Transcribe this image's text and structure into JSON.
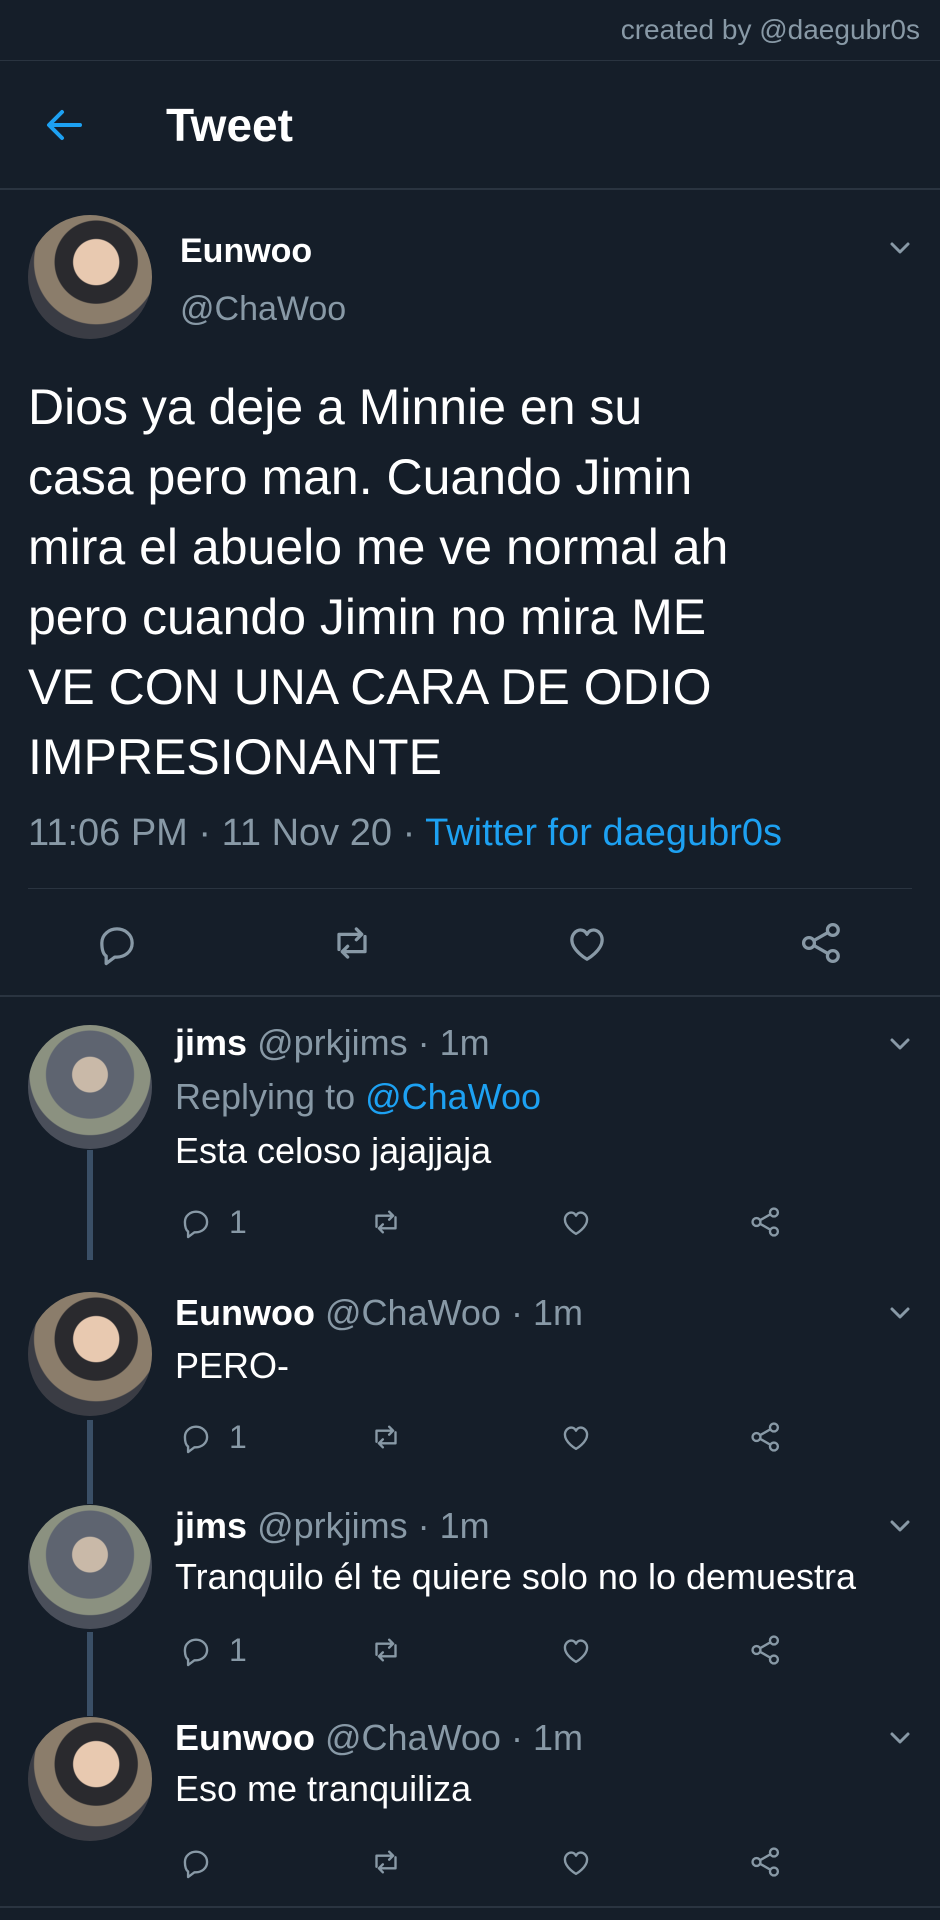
{
  "credit": "created by @daegubr0s",
  "header": {
    "title": "Tweet",
    "back_icon": "arrow-left-icon"
  },
  "main_tweet": {
    "name": "Eunwoo",
    "handle": "@ChaWoo",
    "lines": [
      "Dios ya deje a Minnie en su",
      "casa pero man. Cuando Jimin",
      "mira el abuelo me ve normal ah",
      "pero cuando Jimin no mira ME",
      "VE CON UNA CARA DE ODIO",
      "IMPRESIONANTE"
    ],
    "time": "11:06 PM · 11 Nov 20 · ",
    "source": "Twitter for daegubr0s"
  },
  "replies": [
    {
      "name": "jims",
      "handle_time": "@prkjims · 1m",
      "replying_prefix": "Replying to ",
      "replying_to": "@ChaWoo",
      "text": "Esta celoso jajajjaja",
      "reply_count": "1"
    },
    {
      "name": "Eunwoo",
      "handle_time": "@ChaWoo · 1m",
      "text": "PERO-",
      "reply_count": "1"
    },
    {
      "name": "jims",
      "handle_time": "@prkjims · 1m",
      "text": "Tranquilo él te quiere solo no lo demuestra",
      "reply_count": "1"
    },
    {
      "name": "Eunwoo",
      "handle_time": "@ChaWoo · 1m",
      "text": "Eso me tranquiliza",
      "reply_count": ""
    }
  ],
  "colors": {
    "background": "#151e29",
    "accent": "#1da1f2",
    "muted": "#8899a6",
    "thread": "#3a4f66"
  }
}
